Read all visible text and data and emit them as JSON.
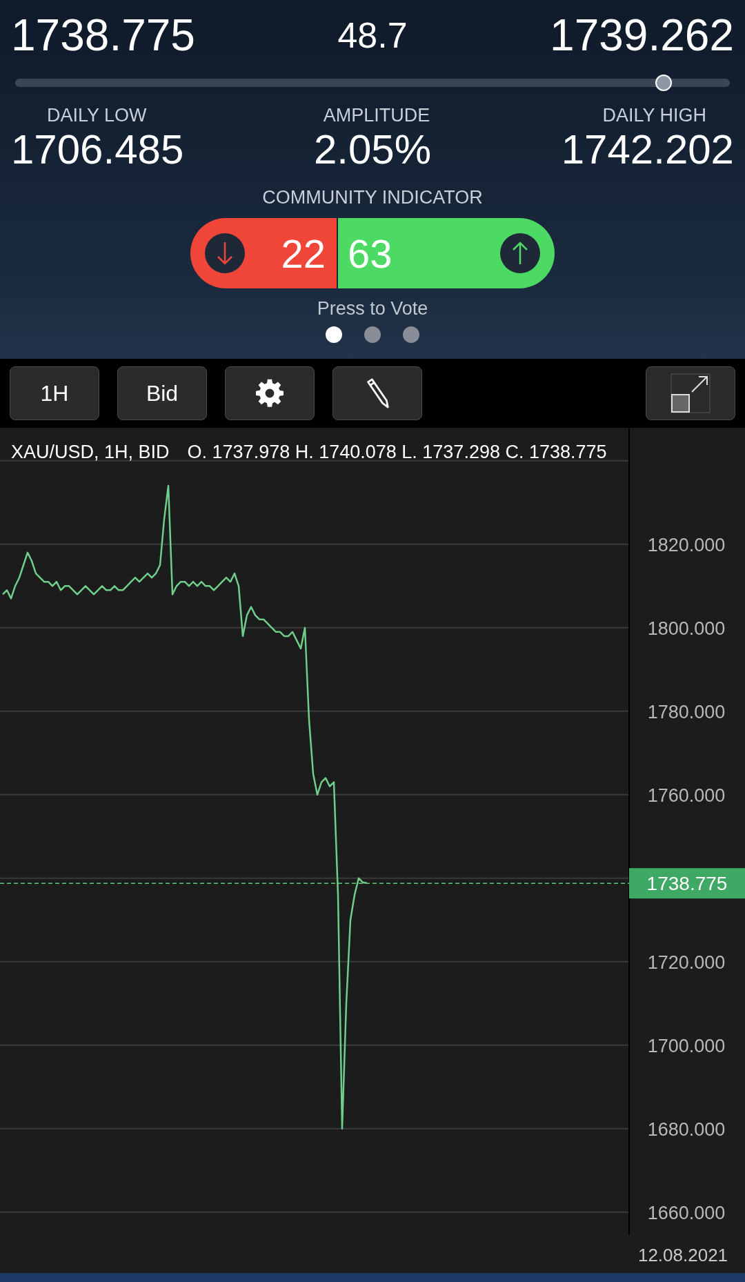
{
  "quote": {
    "bid": "1738.775",
    "spread": "48.7",
    "ask": "1739.262",
    "level": 0.906
  },
  "stats": [
    {
      "label": "DAILY LOW",
      "value": "1706.485"
    },
    {
      "label": "AMPLITUDE",
      "value": "2.05%"
    },
    {
      "label": "DAILY HIGH",
      "value": "1742.202"
    }
  ],
  "community": {
    "title": "COMMUNITY INDICATOR",
    "sell": "22",
    "buy": "63",
    "hint": "Press to Vote"
  },
  "pages": [
    {
      "selected": true
    },
    {
      "selected": false
    },
    {
      "selected": false
    }
  ],
  "toolbar": [
    {
      "kind": "text",
      "label": "1H"
    },
    {
      "kind": "text",
      "label": "Bid"
    },
    {
      "kind": "gear"
    },
    {
      "kind": "pencil"
    },
    {
      "kind": "expand"
    }
  ],
  "chart": {
    "symbol": "XAU/USD, 1H, BID",
    "ohlc": "O. 1737.978 H. 1740.078 L. 1737.298 C. 1738.775",
    "date": "12.08.2021",
    "chart_data": {
      "type": "line",
      "grid": true,
      "ref_lines": [
        {
          "axis": "y",
          "value": 1738.775,
          "label": "1738.775"
        }
      ],
      "ylim": [
        1654.5,
        1847.9
      ],
      "yticks": [
        {
          "value": 1660,
          "label": "1660.000"
        },
        {
          "value": 1680,
          "label": "1680.000"
        },
        {
          "value": 1700,
          "label": "1700.000"
        },
        {
          "value": 1720,
          "label": "1720.000"
        },
        {
          "value": 1760,
          "label": "1760.000"
        },
        {
          "value": 1780,
          "label": "1780.000"
        },
        {
          "value": 1800,
          "label": "1800.000"
        },
        {
          "value": 1820,
          "label": "1820.000"
        }
      ],
      "series": [
        {
          "color": "#6fcf8a",
          "values": [
            1808,
            1809,
            1807,
            1810,
            1812,
            1815,
            1818,
            1816,
            1813,
            1812,
            1811,
            1811,
            1810,
            1811,
            1809,
            1810,
            1810,
            1809,
            1808,
            1809,
            1810,
            1809,
            1808,
            1809,
            1810,
            1809,
            1809,
            1810,
            1809,
            1809,
            1810,
            1811,
            1812,
            1811,
            1812,
            1813,
            1812,
            1813,
            1815,
            1826,
            1834,
            1808,
            1810,
            1811,
            1811,
            1810,
            1811,
            1810,
            1811,
            1810,
            1810,
            1809,
            1810,
            1811,
            1812,
            1811,
            1813,
            1810,
            1798,
            1803,
            1805,
            1803,
            1802,
            1802,
            1801,
            1800,
            1799,
            1799,
            1798,
            1798,
            1799,
            1797,
            1795,
            1800,
            1778,
            1765,
            1760,
            1763,
            1764,
            1762,
            1763,
            1736,
            1680,
            1710,
            1730,
            1736,
            1740,
            1739,
            1738.8
          ]
        }
      ]
    }
  }
}
